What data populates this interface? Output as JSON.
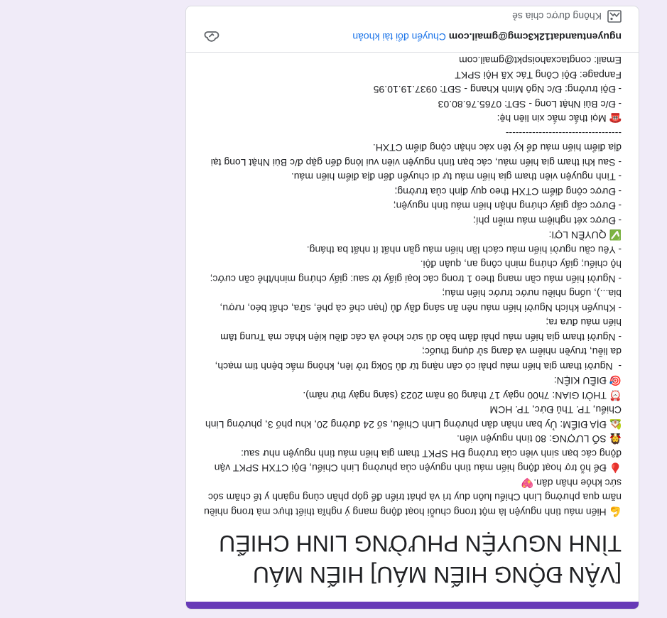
{
  "form": {
    "title": "[VẬN ĐỘNG HIẾN MÁU] HIẾN MÁU TÌNH NGUYỆN PHƯỜNG LINH CHIỂU",
    "description_lines": [
      "💪 Hiến máu tình nguyện là một trong chuỗi hoạt động mang ý nghĩa thiết thực mà trong nhiều năm qua phường Linh Chiểu luôn duy trì và phát triển để góp phần cùng ngành y tế chăm sóc sức khỏe nhân dân.💖",
      "🩸 Để hỗ trợ hoạt động hiến máu tình nguyện của phường Linh Chiểu, Đội CTXH SPKT vận động các bạn sinh viên của trường ĐH SPKT tham gia hiến máu tình nguyện như sau:",
      "🧛 SỐ LƯỢNG: 80 tình nguyện viên.",
      "🏡 ĐỊA ĐIỂM: Ủy ban nhân dân phường Linh Chiểu, số 24 đường 20, khu phố 3, phường Linh Chiểu, TP. Thủ Đức, TP. HCM",
      "⏰ THỜI GIAN: 7h00 ngày 17 tháng 08 năm 2023 (sáng ngày thứ năm).",
      "🎯 ĐIỀU KIỆN:",
      "-  Người tham gia hiến máu phải có cân nặng từ đủ 50kg trở lên, không mắc bệnh tim mạch, da liễu, truyền nhiễm và đang sử dụng thuốc;",
      "- Người tham gia hiến máu phải đảm bảo đủ sức khoẻ và các điều kiện khác mà Trung tâm hiến máu đưa ra;",
      "- Khuyến khích Người hiến máu nên ăn sáng đầy đủ (hạn chế cà phê, sữa, chất béo, rượu, bia...), uống nhiều nước trước hiến máu;",
      "- Người hiến máu cần mang theo 1 trong các loại giấy tờ sau: giấy chứng minh/thẻ căn cước; hộ chiếu; giấy chứng minh công an, quân đội.",
      "- Yêu cầu người hiến máu cách lần hiến máu gần nhất ít nhất ba tháng.",
      "✅ QUYỀN LỢI:",
      "- Được xét nghiệm máu miễn phí;",
      "- Được cấp giấy chứng nhận hiến máu tình nguyện;",
      "- Được cộng điểm CTXH theo quy định của trường;",
      "- Tình nguyện viên tham gia hiến máu tự di chuyển đến địa điểm hiến máu.",
      "- Sau khi tham gia hiến máu, các bạn tình nguyện viên vui lòng đến gặp đ/c Bùi Nhật Long tại địa điểm hiến máu để ký tên xác nhận cộng điểm CTXH.",
      "-----------------------------------",
      "☎️ Mọi thắc mắc xin liên hệ:",
      "- Đ/c Bùi Nhật Long - SĐT: 0765.76.80.03",
      "- Đội trưởng: Đ/c Ngô Minh Khang - SĐT: 0937.19.10.95",
      "Fanpage: Đội Công Tác Xã Hội SPKT",
      "Email: congtacxahoispkt@gmail.com"
    ]
  },
  "account": {
    "email": "nguyentuandat12k3cmg@gmail.com",
    "switch_label": "Chuyển đổi tài khoản",
    "share_note": "Không được chia sẻ"
  },
  "colors": {
    "accent": "#673ab7",
    "link": "#1a73e8",
    "background": "#f0ebf8"
  }
}
